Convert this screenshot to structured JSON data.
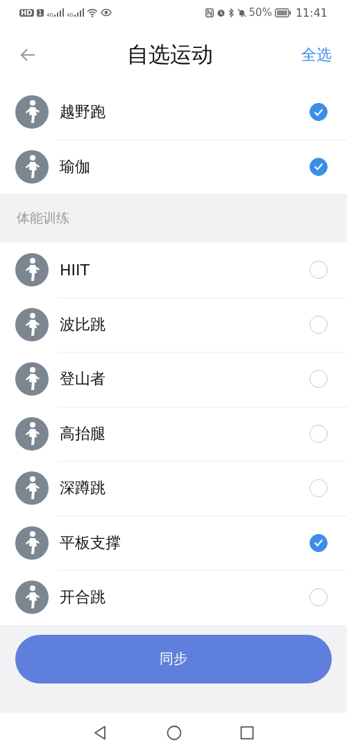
{
  "status_bar": {
    "hd": "HD",
    "sim": "1",
    "net_1": "4G",
    "net_2": "4G",
    "battery": "50%",
    "time": "11:41"
  },
  "header": {
    "title": "自选运动",
    "action": "全选"
  },
  "sections": [
    {
      "items": [
        {
          "name": "越野跑",
          "checked": true
        },
        {
          "name": "瑜伽",
          "checked": true
        }
      ]
    },
    {
      "title": "体能训练",
      "items": [
        {
          "name": "HIIT",
          "checked": false
        },
        {
          "name": "波比跳",
          "checked": false
        },
        {
          "name": "登山者",
          "checked": false
        },
        {
          "name": "高抬腿",
          "checked": false
        },
        {
          "name": "深蹲跳",
          "checked": false
        },
        {
          "name": "平板支撑",
          "checked": true
        },
        {
          "name": "开合跳",
          "checked": false
        }
      ]
    }
  ],
  "sync_button": "同步"
}
